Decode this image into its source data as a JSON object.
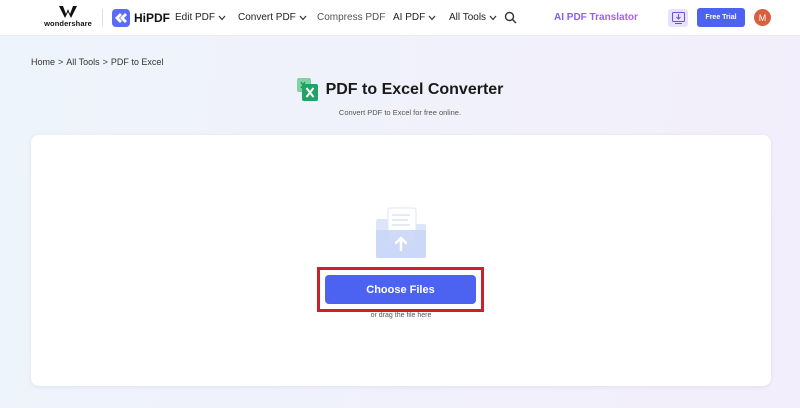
{
  "header": {
    "brand_word": "wondershare",
    "product": "HiPDF",
    "nav": [
      {
        "label": "Edit PDF",
        "dropdown": true
      },
      {
        "label": "Convert PDF",
        "dropdown": true
      },
      {
        "label": "Compress PDF",
        "dropdown": false
      },
      {
        "label": "AI PDF",
        "dropdown": true
      },
      {
        "label": "All Tools",
        "dropdown": true
      }
    ],
    "translator": "AI PDF Translator",
    "free_trial": "Free Trial",
    "avatar_initial": "M"
  },
  "breadcrumb": [
    "Home",
    "All Tools",
    "PDF to Excel"
  ],
  "breadcrumb_separator": ">",
  "page": {
    "title": "PDF to Excel Converter",
    "subtitle": "Convert PDF to Excel for free online."
  },
  "upload": {
    "button_label": "Choose Files",
    "drag_hint": "or drag the file here"
  },
  "colors": {
    "accent": "#4b63f0",
    "highlight": "#c8232c",
    "excel_green": "#21a366",
    "translator_gradient": [
      "#7b5cf5",
      "#b45ce8"
    ]
  },
  "icons": [
    "wondershare-logo-icon",
    "hipdf-logo-icon",
    "chevron-down-icon",
    "search-icon",
    "download-icon",
    "excel-icon",
    "folder-upload-icon"
  ]
}
